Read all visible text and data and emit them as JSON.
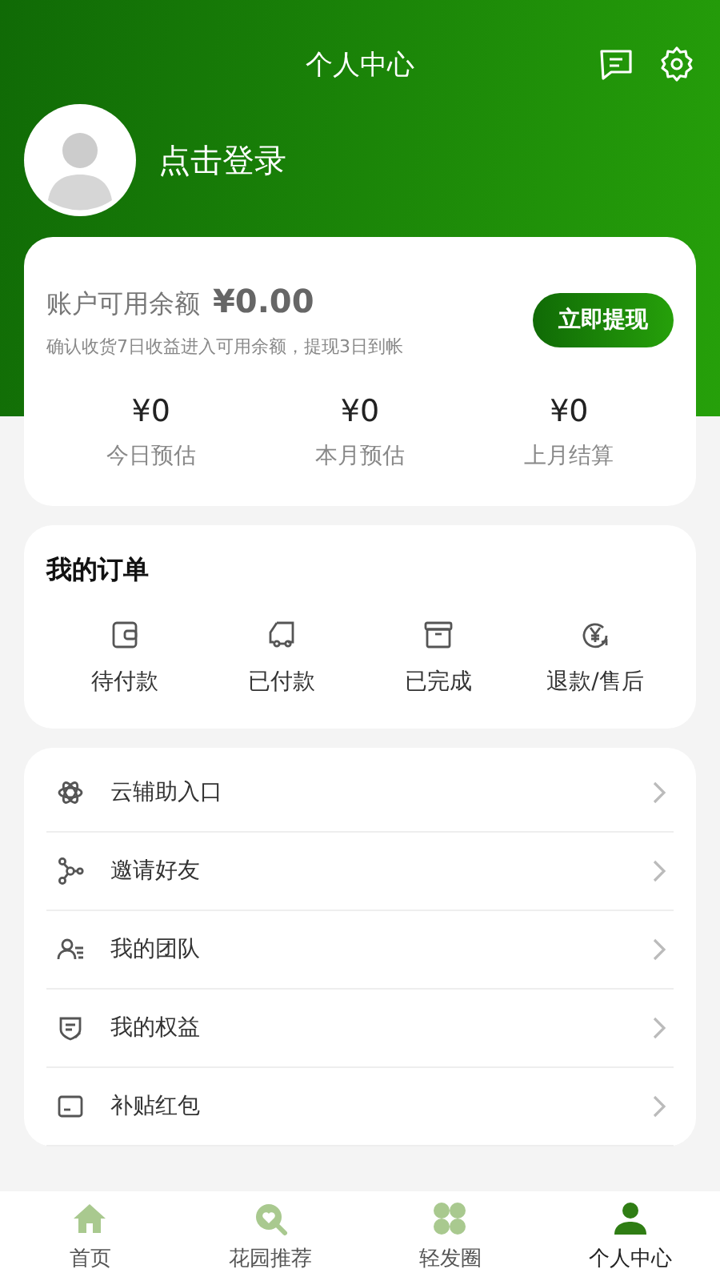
{
  "header": {
    "title": "个人中心",
    "login_text": "点击登录"
  },
  "balance": {
    "label": "账户可用余额",
    "amount": "¥0.00",
    "note": "确认收货7日收益进入可用余额，提现3日到帐",
    "button": "立即提现",
    "stats": [
      {
        "value": "¥0",
        "label": "今日预估"
      },
      {
        "value": "¥0",
        "label": "本月预估"
      },
      {
        "value": "¥0",
        "label": "上月结算"
      }
    ]
  },
  "orders": {
    "title": "我的订单",
    "items": [
      {
        "kind": "wallet",
        "label": "待付款"
      },
      {
        "kind": "truck",
        "label": "已付款"
      },
      {
        "kind": "box",
        "label": "已完成"
      },
      {
        "kind": "refund",
        "label": "退款/售后"
      }
    ]
  },
  "menu": [
    {
      "kind": "atom",
      "label": "云辅助入口"
    },
    {
      "kind": "share",
      "label": "邀请好友"
    },
    {
      "kind": "team",
      "label": "我的团队"
    },
    {
      "kind": "shield",
      "label": "我的权益"
    },
    {
      "kind": "card",
      "label": "补贴红包"
    }
  ],
  "tabs": [
    {
      "kind": "home",
      "label": "首页",
      "selected": false
    },
    {
      "kind": "heart",
      "label": "花园推荐",
      "selected": false
    },
    {
      "kind": "clover",
      "label": "轻发圈",
      "selected": false
    },
    {
      "kind": "person",
      "label": "个人中心",
      "selected": true
    }
  ]
}
